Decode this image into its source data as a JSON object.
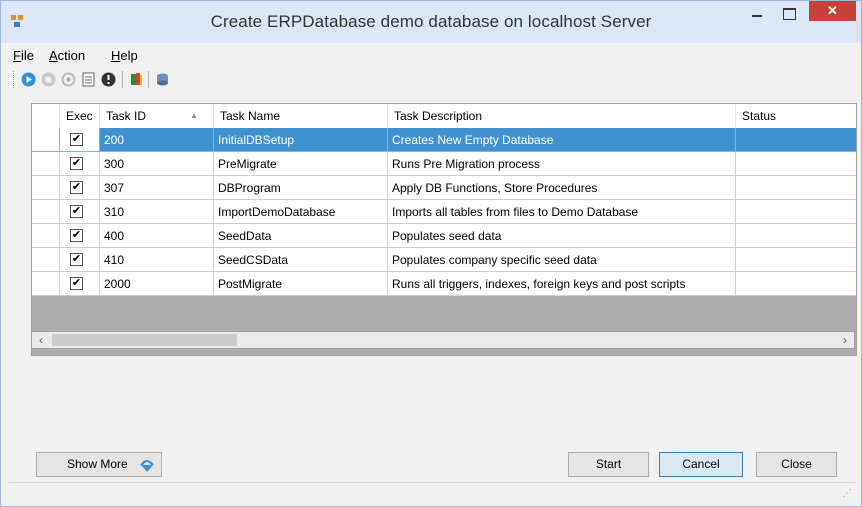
{
  "window": {
    "title": "Create ERPDatabase demo database on localhost Server"
  },
  "menu": {
    "items": [
      "File",
      "Action",
      "Help"
    ],
    "underline": [
      "F",
      "A",
      "H"
    ]
  },
  "toolbar": {
    "icons": [
      "play-icon",
      "stop-icon",
      "refresh-icon",
      "document-icon",
      "info-icon",
      "book-icon",
      "database-icon"
    ]
  },
  "grid": {
    "headers": [
      "Exec",
      "Task ID",
      "Task Name",
      "Task Description",
      "Status"
    ],
    "sort_indicator": "▲",
    "rows": [
      {
        "exec": true,
        "id": "200",
        "name": "InitialDBSetup",
        "description": "Creates New Empty Database",
        "status": "",
        "selected": true
      },
      {
        "exec": true,
        "id": "300",
        "name": "PreMigrate",
        "description": "Runs Pre Migration process",
        "status": ""
      },
      {
        "exec": true,
        "id": "307",
        "name": "DBProgram",
        "description": "Apply DB Functions, Store Procedures",
        "status": ""
      },
      {
        "exec": true,
        "id": "310",
        "name": "ImportDemoDatabase",
        "description": "Imports all tables from files to Demo Database",
        "status": ""
      },
      {
        "exec": true,
        "id": "400",
        "name": "SeedData",
        "description": "Populates seed data",
        "status": ""
      },
      {
        "exec": true,
        "id": "410",
        "name": "SeedCSData",
        "description": "Populates company specific seed data",
        "status": ""
      },
      {
        "exec": true,
        "id": "2000",
        "name": "PostMigrate",
        "description": "Runs all triggers, indexes, foreign keys and post scripts",
        "status": ""
      }
    ]
  },
  "buttons": {
    "show_more": "Show More",
    "start": "Start",
    "cancel": "Cancel",
    "close": "Close"
  },
  "colors": {
    "title_bg": "#dbe7f6",
    "close_bg": "#c7433a",
    "selected_row": "#3f92cf",
    "grid_empty": "#ababab"
  }
}
